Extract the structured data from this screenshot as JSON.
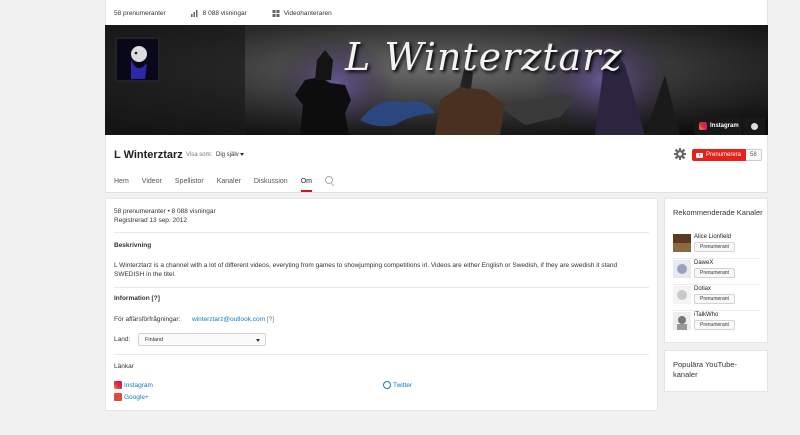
{
  "topbar": {
    "subscribers": "58 prenumeranter",
    "views": "8 088 visningar",
    "video_manager": "Videohanteraren"
  },
  "banner": {
    "title": "L Winterztarz",
    "instagram_label": "Instagram"
  },
  "channel": {
    "name": "L Winterztarz",
    "view_as_label": "Visa som:",
    "view_as_value": "Dig själv",
    "subscribe_label": "Prenumerera",
    "subscriber_count": "58"
  },
  "tabs": [
    {
      "label": "Hem",
      "active": false
    },
    {
      "label": "Videor",
      "active": false
    },
    {
      "label": "Spellistor",
      "active": false
    },
    {
      "label": "Kanaler",
      "active": false
    },
    {
      "label": "Diskussion",
      "active": false
    },
    {
      "label": "Om",
      "active": true
    }
  ],
  "about": {
    "stats": "58 prenumeranter • 8 088 visningar",
    "registered": "Registrerad 13 sep. 2012",
    "description_heading": "Beskrivning",
    "description": "L Winterztarz is a channel with a lot of different videos, everyting from games to showjumping competitions irl. Videos are either English or Swedish, if they are swedish it stand SWEDISH in the titel.",
    "info_heading": "Information [?]",
    "business_label": "För affärsförfrågningar:",
    "business_email": "winterztarz@outlook.com",
    "business_help": "[?]",
    "country_label": "Land:",
    "country_value": "Finland",
    "links_heading": "Länkar",
    "links": [
      {
        "label": "Instagram",
        "icon": "instagram-icon",
        "color": "#c13584"
      },
      {
        "label": "Twitter",
        "icon": "twitter-globe-icon",
        "color": "#167ac6"
      },
      {
        "label": "Google+",
        "icon": "googleplus-icon",
        "color": "#dd4b39"
      }
    ]
  },
  "recommended": {
    "title": "Rekommenderade Kanaler",
    "button_label": "Prenumerant",
    "channels": [
      {
        "name": "Alice Lionfield"
      },
      {
        "name": "DaweX"
      },
      {
        "name": "Dotiax"
      },
      {
        "name": "iTalkWho"
      }
    ]
  },
  "popular": {
    "title": "Populära YouTube-kanaler"
  },
  "colors": {
    "accent_red": "#e62117",
    "link_blue": "#167ac6",
    "tab_active": "#cc181e"
  }
}
